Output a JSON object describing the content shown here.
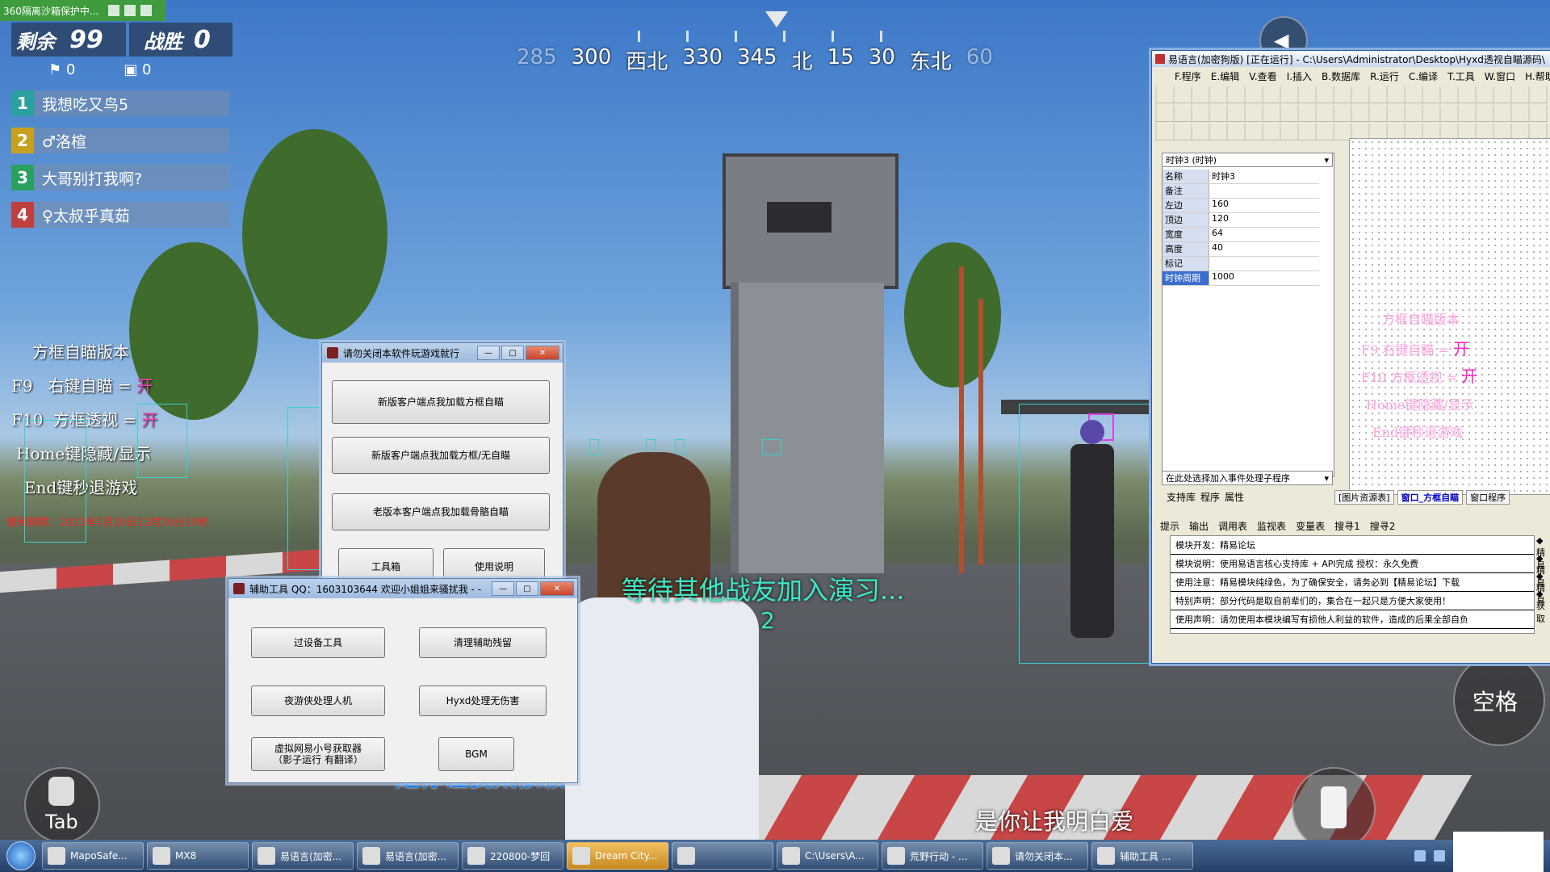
{
  "sandbox": {
    "label": "360隔离沙箱保护中..."
  },
  "hud": {
    "alive_label": "剩余",
    "alive_count": "99",
    "kills_label": "战胜",
    "kills_count": "0",
    "stat_a": "0",
    "stat_b": "0",
    "team": [
      {
        "num": "1",
        "name": "我想吃又鸟5",
        "color": "#2aa0a0"
      },
      {
        "num": "2",
        "name": "♂洛楦",
        "color": "#c8a020"
      },
      {
        "num": "3",
        "name": "大哥别打我啊?",
        "color": "#2aa060"
      },
      {
        "num": "4",
        "name": "♀太叔乎真茹",
        "color": "#c04040"
      }
    ],
    "compass": [
      "285",
      "300",
      "西北",
      "330",
      "345",
      "北",
      "15",
      "30",
      "东北",
      "60"
    ],
    "space_label": "空格",
    "tab_label": "Tab"
  },
  "overlay": {
    "title": "方框自瞄版本",
    "f9_key": "F9",
    "f9_text": "右键自瞄 =",
    "f9_state": "开",
    "f10_key": "F10",
    "f10_text": "方框透视 =",
    "f10_state": "开",
    "home_text": "Home键隐藏/显示",
    "end_text": "End键秒退游戏",
    "red_text": "使用期限：2023年1月20日12时30分10秒"
  },
  "subtitles": {
    "waiting": "等待其他战友加入演习...",
    "waiting_count": "2",
    "line_left": "是你让我太依赖",
    "line_right": "是你让我明白爱"
  },
  "loader_window": {
    "title": "请勿关闭本软件玩游戏就行",
    "buttons": [
      "新版客户端点我加载方框自瞄",
      "新版客户端点我加载方框/无自瞄",
      "老版本客户端点我加载骨骼自瞄",
      "工具箱",
      "使用说明"
    ]
  },
  "helper_window": {
    "title": "辅助工具  QQ：1603103644  欢迎小姐姐来骚扰我 - -",
    "buttons": [
      "过设备工具",
      "清理辅助残留",
      "夜游侠处理人机",
      "Hyxd处理无伤害",
      "虚拟网易小号获取器\n（影子运行 有翻译）",
      "BGM"
    ]
  },
  "ide": {
    "title": "易语言(加密狗版) [正在运行] - C:\\Users\\Administrator\\Desktop\\Hyxd透视自瞄源码\\",
    "menu": [
      "F.程序",
      "E.编辑",
      "V.查看",
      "I.插入",
      "B.数据库",
      "R.运行",
      "C.编译",
      "T.工具",
      "W.窗口",
      "H.帮助"
    ],
    "prop_select": "时钟3 (时钟)",
    "props": [
      {
        "k": "名称",
        "v": "时钟3"
      },
      {
        "k": "备注",
        "v": ""
      },
      {
        "k": "左边",
        "v": "160"
      },
      {
        "k": "顶边",
        "v": "120"
      },
      {
        "k": "宽度",
        "v": "64"
      },
      {
        "k": "高度",
        "v": "40"
      },
      {
        "k": "标记",
        "v": ""
      },
      {
        "k": "时钟周期",
        "v": "1000"
      }
    ],
    "event_select": "在此处选择加入事件处理子程序",
    "left_tabs": [
      "支持库",
      "程序",
      "属性"
    ],
    "doc_tabs": [
      "[图片资源表]",
      "窗口_方框自瞄",
      "窗口程序"
    ],
    "bottom_tabs": [
      "提示",
      "输出",
      "调用表",
      "监视表",
      "变量表",
      "搜寻1",
      "搜寻2"
    ],
    "messages": [
      "模块开发：精易论坛",
      "模块说明：使用易语言核心支持库 + API完成      授权：永久免费",
      "使用注意：精易模块纯绿色，为了确保安全，请务必到【精易论坛】下载",
      "特别声明：部分代码是取自前辈们的，集合在一起只是方便大家使用！",
      "使用声明：请勿使用本模块编写有损他人利益的软件，造成的后果全部自负"
    ],
    "msg_side": [
      "◆精易",
      "◆精易",
      "◆精易",
      "◆获取"
    ],
    "design": {
      "title": "方框自瞄版本",
      "f9": "F9  右键自瞄 =",
      "f9_state": "开",
      "f10": "F10  方框透视 =",
      "f10_state": "开",
      "home": "Home键隐藏/显示",
      "end": "End键秒退游戏"
    }
  },
  "taskbar": {
    "items": [
      "MapoSafe...",
      "MX8",
      "易语言(加密...",
      "易语言(加密...",
      "220800-梦回",
      "Dream City...",
      "",
      "C:\\Users\\A...",
      "荒野行动 - ...",
      "请勿关闭本...",
      "辅助工具 ..."
    ]
  }
}
